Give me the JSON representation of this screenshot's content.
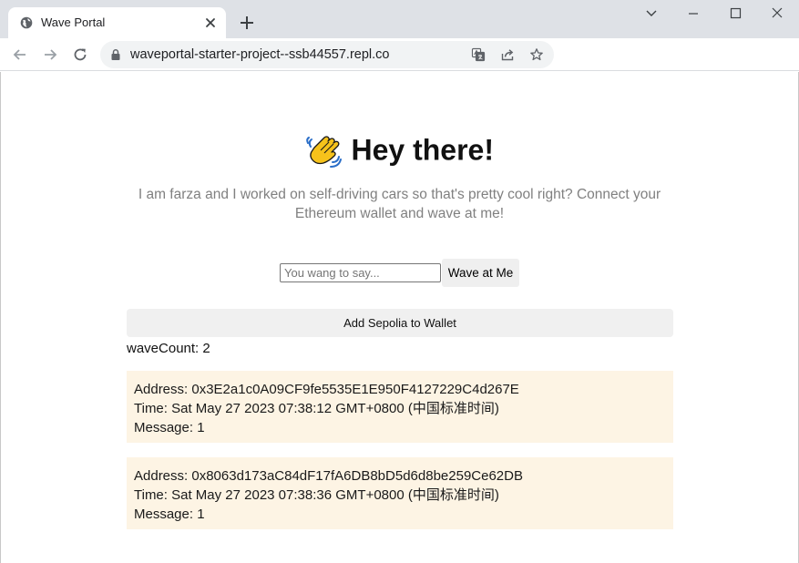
{
  "browser": {
    "tab_title": "Wave Portal",
    "url": "waveportal-starter-project--ssb44557.repl.co",
    "icons": {
      "favicon": "globe-icon",
      "close": "close-icon",
      "new_tab": "plus-icon",
      "back": "back-arrow-icon",
      "forward": "forward-arrow-icon",
      "reload": "reload-icon",
      "lock": "lock-icon",
      "translate": "translate-icon",
      "share": "share-icon",
      "bookmark": "star-icon"
    }
  },
  "page": {
    "title": "Hey there!",
    "emoji": "waving-hand-icon",
    "bio": "I am farza and I worked on self-driving cars so that's pretty cool right? Connect your Ethereum wallet and wave at me!",
    "input_placeholder": "You wang to say...",
    "input_value": "",
    "wave_button": "Wave at Me",
    "sepolia_button": "Add Sepolia to Wallet",
    "wave_count": "waveCount: 2",
    "waves": [
      {
        "address": "Address: 0x3E2a1c0A09CF9fe5535E1E950F4127229C4d267E",
        "time": "Time: Sat May 27 2023 07:38:12 GMT+0800 (中国标准时间)",
        "message": "Message: 1"
      },
      {
        "address": "Address: 0x8063d173aC84dF17fA6DB8bD5d6d8be259Ce62DB",
        "time": "Time: Sat May 27 2023 07:38:36 GMT+0800 (中国标准时间)",
        "message": "Message: 1"
      }
    ]
  },
  "colors": {
    "card_background": "#fdf4e4",
    "bio_text": "#808080",
    "chrome_background": "#dee1e6"
  }
}
